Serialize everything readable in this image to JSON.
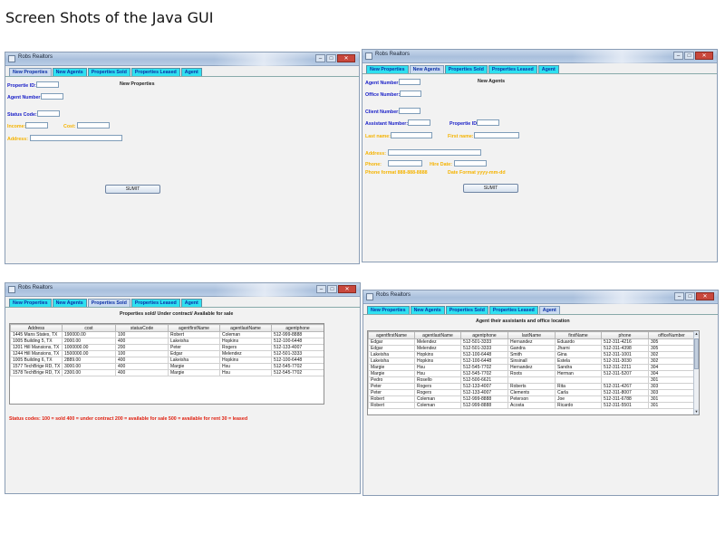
{
  "page_title": "Screen Shots of the Java GUI",
  "window_title": "Robs Realtors",
  "tabs": [
    "New Properties",
    "New Agents",
    "Properties Sold",
    "Properties Leased",
    "Agent"
  ],
  "colors": {
    "tab": "#2fe0f0",
    "label_blue": "#1a20c8",
    "label_yellow": "#f5b300",
    "label_red": "#e02010"
  },
  "new_properties": {
    "heading": "New Properties",
    "propertie_id": "Propertie ID:",
    "agent_number": "Agent Number:",
    "status_code": "Status Code:",
    "income": "Income:",
    "cost": "Cost:",
    "address": "Address:",
    "submit": "SUMIT"
  },
  "new_agents": {
    "heading": "New Agents",
    "agent_number": "Agent Number:",
    "office_number": "Office Number:",
    "client_number": "Client Number:",
    "assistant_number": "Assistant Number:",
    "propertie_id": "Propertie ID:",
    "last_name": "Last name:",
    "first_name": "First name:",
    "address": "Address:",
    "phone": "Phone:",
    "hire_date": "Hire Date:",
    "phone_format": "Phone format 888-888-8888",
    "date_format": "Date Format yyyy-mm-dd",
    "submit": "SUMIT"
  },
  "properties_sold": {
    "heading": "Properties sold/ Under contract/ Available for sale",
    "columns": [
      "Address",
      "cost",
      "statusCode",
      "agentfirstName",
      "agentlastName",
      "agentphone"
    ],
    "rows": [
      [
        "1445 Mans States, TX",
        "190000.00",
        "100",
        "Robert",
        "Coleman",
        "512-999-8888"
      ],
      [
        "1005 Building 5, TX",
        "2000.00",
        "400",
        "Lakeisha",
        "Hopkins",
        "512-100-6448"
      ],
      [
        "1201 Hill Mansions, TX",
        "1000000.00",
        "200",
        "Peter",
        "Rogers",
        "512-133-4007"
      ],
      [
        "1244 Hill Mansions, TX",
        "1500000.00",
        "100",
        "Edgar",
        "Melendez",
        "512-501-3333"
      ],
      [
        "1005 Building 6, TX",
        "2889.00",
        "400",
        "Lakeisha",
        "Hopkins",
        "512-100-6448"
      ],
      [
        "1577 TechBrige RD, TX",
        "3000.00",
        "400",
        "Margie",
        "Hsu",
        "512-545-7702"
      ],
      [
        "1578 TechBrige RD, TX",
        "2300.00",
        "400",
        "Margie",
        "Hsu",
        "512-545-7702"
      ]
    ],
    "status_codes": "Status codes:   100 = sold   400 = under contract   200 = available for sale   500 = available for rent   30 = leased"
  },
  "agent_info": {
    "heading": "Agent their assistants and office location",
    "columns": [
      "agentfirstName",
      "agentlastName",
      "agentphone",
      "lastName",
      "firstName",
      "phone",
      "officeNumber"
    ],
    "rows": [
      [
        "Edgar",
        "Melendez",
        "512-501-3333",
        "Hernandez",
        "Eduardo",
        "512-311-4216",
        "305"
      ],
      [
        "Edgar",
        "Melendez",
        "512-501-3333",
        "Gandra",
        "Jharni",
        "512-311-4398",
        "305"
      ],
      [
        "Lakeisha",
        "Hopkins",
        "512-100-6448",
        "Smith",
        "Gina",
        "512-311-1001",
        "302"
      ],
      [
        "Lakeisha",
        "Hopkins",
        "512-100-6448",
        "Sinsinall",
        "Estela",
        "512-311-3030",
        "302"
      ],
      [
        "Margie",
        "Hsu",
        "512-545-7702",
        "Hernandez",
        "Sandra",
        "512-311-2211",
        "304"
      ],
      [
        "Margie",
        "Hsu",
        "512-545-7702",
        "Roots",
        "Herman",
        "512-311-5207",
        "304"
      ],
      [
        "Pedro",
        "Rosello",
        "512-500-6621",
        "",
        "",
        "",
        "301"
      ],
      [
        "Peter",
        "Rogers",
        "512-133-4007",
        "Roberts",
        "Rita",
        "512-311-4267",
        "303"
      ],
      [
        "Peter",
        "Rogers",
        "512-133-4007",
        "Clements",
        "Carla",
        "512-311-8007",
        "303"
      ],
      [
        "Robert",
        "Coleman",
        "512-999-8888",
        "Peterson",
        "Joe",
        "512-311-6788",
        "301"
      ],
      [
        "Robert",
        "Coleman",
        "512-999-8888",
        "Acosta",
        "Ricardo",
        "512-311-5501",
        "301"
      ]
    ]
  }
}
